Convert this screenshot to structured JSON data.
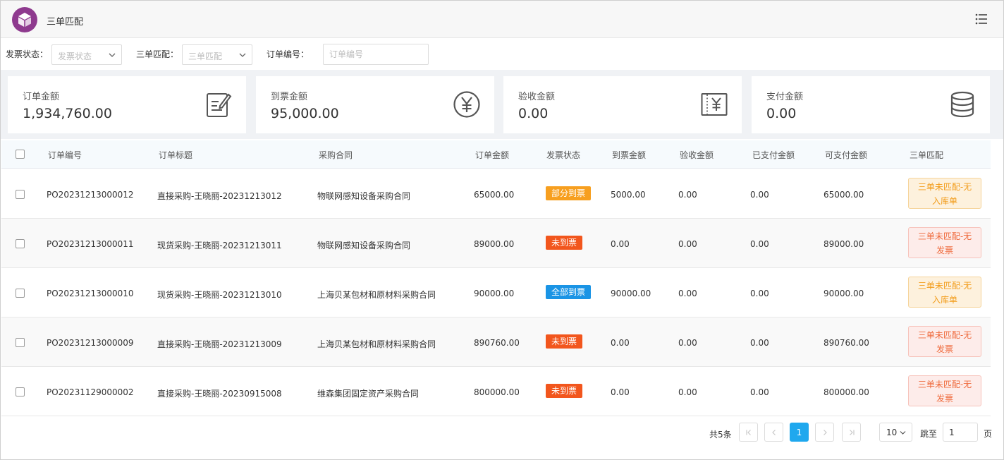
{
  "header": {
    "title": "三单匹配",
    "logo_icon": "box-icon",
    "menu_icon": "list-menu-icon"
  },
  "filters": {
    "invoice_status": {
      "label": "发票状态：",
      "placeholder": "发票状态"
    },
    "three_way_match": {
      "label": "三单匹配：",
      "placeholder": "三单匹配"
    },
    "order_no": {
      "label": "订单编号：",
      "placeholder": "订单编号"
    }
  },
  "stats": [
    {
      "label": "订单金额",
      "value": "1,934,760.00",
      "icon": "edit-document-icon"
    },
    {
      "label": "到票金额",
      "value": "95,000.00",
      "icon": "yuan-circle-icon"
    },
    {
      "label": "验收金额",
      "value": "0.00",
      "icon": "yuan-ticket-icon"
    },
    {
      "label": "支付金额",
      "value": "0.00",
      "icon": "database-icon"
    }
  ],
  "table": {
    "columns": [
      "订单编号",
      "订单标题",
      "采购合同",
      "订单金额",
      "发票状态",
      "到票金额",
      "验收金额",
      "已支付金额",
      "可支付金额",
      "三单匹配"
    ],
    "rows": [
      {
        "order_no": "PO20231213000012",
        "title": "直接采购-王晓丽-20231213012",
        "contract": "物联网感知设备采购合同",
        "amount": "65000.00",
        "invoice_status": "部分到票",
        "invoiced": "5000.00",
        "accepted": "0.00",
        "paid": "0.00",
        "payable": "65000.00",
        "match_line1": "三单未匹配-无",
        "match_line2": "入库单"
      },
      {
        "order_no": "PO20231213000011",
        "title": "现货采购-王晓丽-20231213011",
        "contract": "物联网感知设备采购合同",
        "amount": "89000.00",
        "invoice_status": "未到票",
        "invoiced": "0.00",
        "accepted": "0.00",
        "paid": "0.00",
        "payable": "89000.00",
        "match_line1": "三单未匹配-无",
        "match_line2": "发票"
      },
      {
        "order_no": "PO20231213000010",
        "title": "现货采购-王晓丽-20231213010",
        "contract": "上海贝某包材和原材料采购合同",
        "amount": "90000.00",
        "invoice_status": "全部到票",
        "invoiced": "90000.00",
        "accepted": "0.00",
        "paid": "0.00",
        "payable": "90000.00",
        "match_line1": "三单未匹配-无",
        "match_line2": "入库单"
      },
      {
        "order_no": "PO20231213000009",
        "title": "直接采购-王晓丽-20231213009",
        "contract": "上海贝某包材和原材料采购合同",
        "amount": "890760.00",
        "invoice_status": "未到票",
        "invoiced": "0.00",
        "accepted": "0.00",
        "paid": "0.00",
        "payable": "890760.00",
        "match_line1": "三单未匹配-无",
        "match_line2": "发票"
      },
      {
        "order_no": "PO20231129000002",
        "title": "直接采购-王晓丽-20230915008",
        "contract": "维森集团固定资产采购合同",
        "amount": "800000.00",
        "invoice_status": "未到票",
        "invoiced": "0.00",
        "accepted": "0.00",
        "paid": "0.00",
        "payable": "800000.00",
        "match_line1": "三单未匹配-无",
        "match_line2": "发票"
      }
    ]
  },
  "colors": {
    "partial": "#f79f1f",
    "none": "#f2561d",
    "full": "#1a94e5",
    "active_page": "#1fa8ee",
    "logo": "#8e3a8e"
  },
  "pagination": {
    "total": "共5条",
    "current_page": "1",
    "page_size": "10",
    "jump_label": "跳至",
    "jump_value": "1",
    "page_suffix": "页"
  }
}
